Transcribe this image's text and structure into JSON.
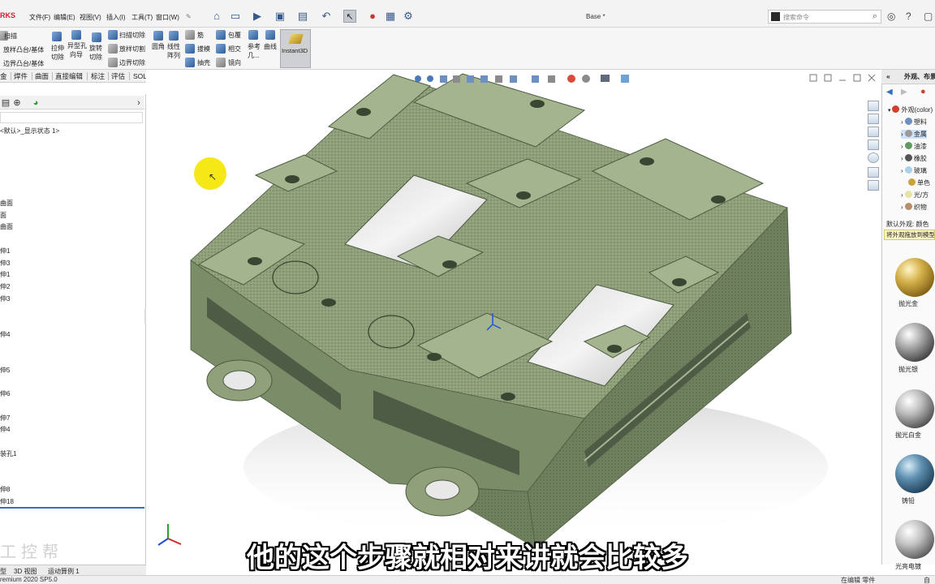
{
  "app": {
    "logo_text": "RKS",
    "document_title": "Base *"
  },
  "menu": [
    "文件(F)",
    "编辑(E)",
    "视图(V)",
    "插入(I)",
    "工具(T)",
    "窗口(W)"
  ],
  "search": {
    "placeholder": "搜索命令"
  },
  "commands": {
    "sweep": "扫描",
    "loft_boss": "放样凸台/基体",
    "boundary_boss": "边界凸台/基体",
    "extruded_cut": [
      "拉伸",
      "切除"
    ],
    "hole_wizard": [
      "异型孔",
      "向导"
    ],
    "revolved_cut": [
      "旋转",
      "切除"
    ],
    "swept_cut": "扫描切除",
    "lofted_cut": "放样切割",
    "boundary_cut": "边界切除",
    "fillet": "圆角",
    "linear_pattern": [
      "线性",
      "阵列"
    ],
    "rib": "筋",
    "draft": "拔模",
    "shell": "抽壳",
    "wrap": "包覆",
    "intersect": "相交",
    "mirror": "镜向",
    "reference": [
      "参考",
      "几..."
    ],
    "curves": "曲线",
    "instant3d": "Instant3D"
  },
  "tabs": [
    "金",
    "焊件",
    "曲面",
    "直接编辑",
    "标注",
    "评估",
    "SOLIDWORKS 插件"
  ],
  "tree": {
    "config": "<默认>_显示状态 1>",
    "items": [
      {
        "label": "曲面"
      },
      {
        "label": "面"
      },
      {
        "label": "曲面"
      },
      {
        "label": "伸1"
      },
      {
        "label": "伸3"
      },
      {
        "label": "伸1"
      },
      {
        "label": "伸2"
      },
      {
        "label": "伸3"
      },
      {
        "label": "伸4"
      },
      {
        "label": "伸5"
      },
      {
        "label": "伸6"
      },
      {
        "label": "伸7"
      },
      {
        "label": "伸4"
      },
      {
        "label": "装孔1"
      },
      {
        "label": "伸8"
      },
      {
        "label": "伸18"
      }
    ]
  },
  "taskpane": {
    "header": "外观、布景",
    "root": "外观(color)",
    "items": [
      "塑料",
      "金属",
      "油漆",
      "橡胶",
      "玻璃",
      "单色",
      "光/方",
      "织物"
    ],
    "default_label": "默认外观: 颜色",
    "tip": "将外观拖放到模型",
    "materials": [
      "抛光金",
      "抛光银",
      "抛光白金",
      "铸铅",
      "光亮电镀"
    ]
  },
  "bottom_tabs": [
    "型",
    "3D 视图",
    "运动算例 1"
  ],
  "status": {
    "left": "remium 2020 SP5.0",
    "right": "在编辑 零件",
    "far_right": "自"
  },
  "subtitle": "他的这个步骤就相对来讲就会比较多",
  "watermark": "工控帮",
  "colors": {
    "model_face": "#8fa07a",
    "model_side": "#6f805e",
    "model_top_light": "#a7b893",
    "brand_red": "#d2202f",
    "cursor_highlight": "#f5e609",
    "selection_blue": "#2f6fbf"
  },
  "icons": [
    "home-icon",
    "new-file-icon",
    "open-icon",
    "save-icon",
    "print-icon",
    "undo-icon",
    "select-icon",
    "traffic-light-icon",
    "options-icon",
    "search-icon",
    "help-icon",
    "user-icon",
    "question-icon",
    "min-icon",
    "restore-icon",
    "close-icon"
  ]
}
